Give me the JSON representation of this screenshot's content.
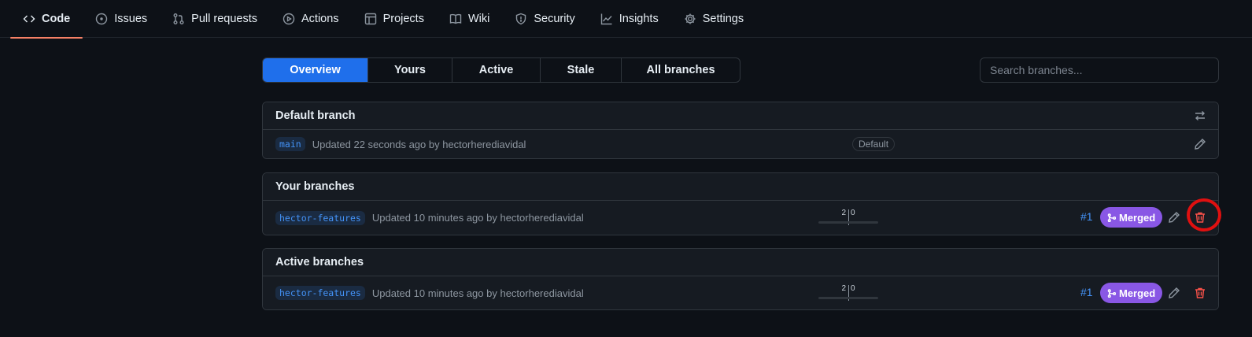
{
  "nav": {
    "items": [
      {
        "label": "Code",
        "icon": "code-icon",
        "selected": true
      },
      {
        "label": "Issues",
        "icon": "issue-icon"
      },
      {
        "label": "Pull requests",
        "icon": "pull-request-icon"
      },
      {
        "label": "Actions",
        "icon": "play-icon"
      },
      {
        "label": "Projects",
        "icon": "table-icon"
      },
      {
        "label": "Wiki",
        "icon": "book-icon"
      },
      {
        "label": "Security",
        "icon": "shield-icon"
      },
      {
        "label": "Insights",
        "icon": "graph-icon"
      },
      {
        "label": "Settings",
        "icon": "gear-icon"
      }
    ]
  },
  "branch_tabs": {
    "overview": "Overview",
    "yours": "Yours",
    "active": "Active",
    "stale": "Stale",
    "all": "All branches",
    "selected": "Overview"
  },
  "search": {
    "placeholder": "Search branches...",
    "value": ""
  },
  "default_section": {
    "title": "Default branch",
    "branch": "main",
    "updated": "Updated 22 seconds ago by hectorherediavidal",
    "badge": "Default"
  },
  "your_section": {
    "title": "Your branches",
    "branch": "hector-features",
    "updated": "Updated 10 minutes ago by hectorherediavidal",
    "behind": "2",
    "ahead": "0",
    "pr": "#1",
    "status": "Merged"
  },
  "active_section": {
    "title": "Active branches",
    "branch": "hector-features",
    "updated": "Updated 10 minutes ago by hectorherediavidal",
    "behind": "2",
    "ahead": "0",
    "pr": "#1",
    "status": "Merged"
  },
  "colors": {
    "accent_blue": "#1f6feb",
    "merged_purple": "#8957e5",
    "danger_red": "#f85149",
    "annotation_red": "#e01010"
  }
}
